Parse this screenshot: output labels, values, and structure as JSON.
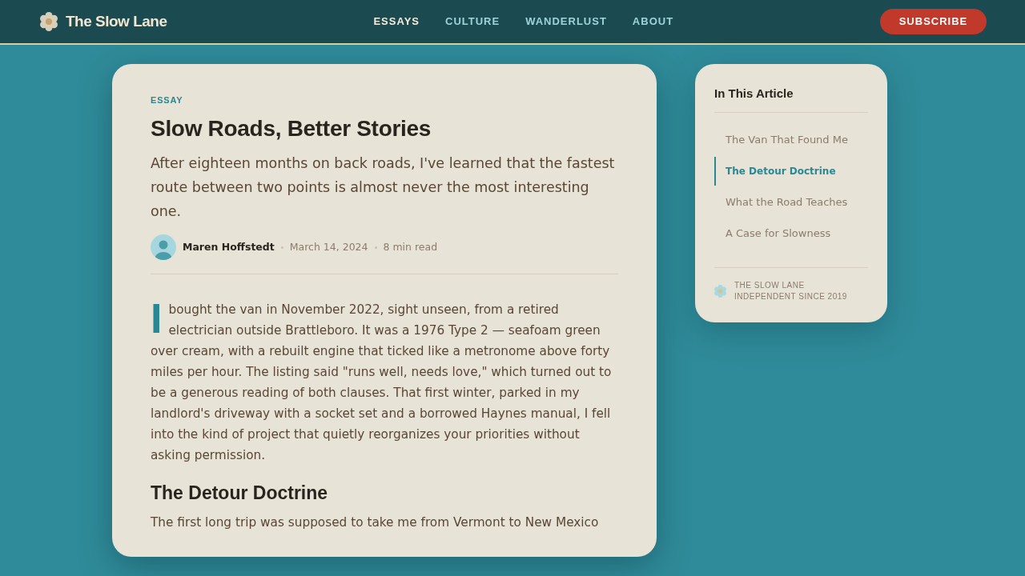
{
  "header": {
    "logo": "The Slow Lane",
    "nav": [
      {
        "label": "ESSAYS",
        "selected": true
      },
      {
        "label": "CULTURE",
        "selected": false
      },
      {
        "label": "WANDERLUST",
        "selected": false
      },
      {
        "label": "ABOUT",
        "selected": false
      }
    ],
    "subscribe": "SUBSCRIBE"
  },
  "article": {
    "category": "ESSAY",
    "title": "Slow Roads, Better Stories",
    "subtitle": "After eighteen months on back roads, I've learned that the fastest route between two points is almost never the most interesting one.",
    "byline": {
      "author": "Maren Hoffstedt",
      "date": "March 14, 2024",
      "read_time": "8 min read"
    },
    "body": [
      {
        "kind": "paragraph",
        "drop_cap": "I",
        "text": "bought the van in November 2022, sight unseen, from a retired electrician outside Brattleboro. It was a 1976 Type 2 — seafoam green over cream, with a rebuilt engine that ticked like a metronome above forty miles per hour. The listing said \"runs well, needs love,\" which turned out to be a generous reading of both clauses. That first winter, parked in my landlord's driveway with a socket set and a borrowed Haynes manual, I fell into the kind of project that quietly reorganizes your priorities without asking permission."
      },
      {
        "kind": "heading",
        "text": "The Detour Doctrine"
      },
      {
        "kind": "paragraph",
        "text": "The first long trip was supposed to take me from Vermont to New Mexico"
      }
    ]
  },
  "toc": {
    "title": "In This Article",
    "items": [
      {
        "label": "The Van That Found Me",
        "selected": false
      },
      {
        "label": "The Detour Doctrine",
        "selected": true
      },
      {
        "label": "What the Road Teaches",
        "selected": false
      },
      {
        "label": "A Case for Slowness",
        "selected": false
      }
    ],
    "footer": [
      "THE SLOW LANE",
      "INDEPENDENT SINCE 2019"
    ]
  }
}
